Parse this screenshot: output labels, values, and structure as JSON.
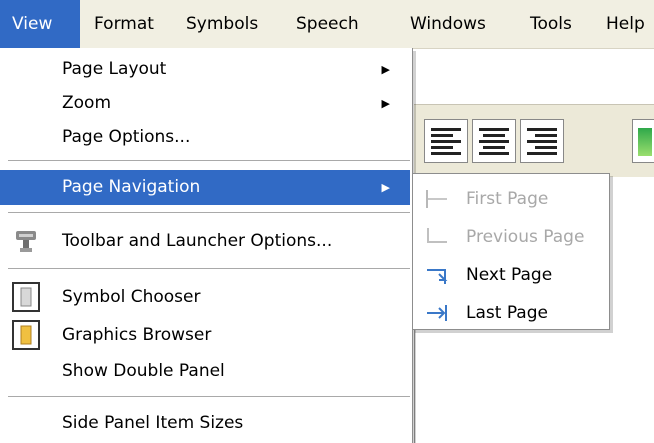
{
  "menubar": {
    "items": [
      {
        "label": "View",
        "active": true
      },
      {
        "label": "Format",
        "active": false
      },
      {
        "label": "Symbols",
        "active": false
      },
      {
        "label": "Speech",
        "active": false
      },
      {
        "label": "Windows",
        "active": false
      },
      {
        "label": "Tools",
        "active": false
      },
      {
        "label": "Help",
        "active": false
      }
    ]
  },
  "view_menu": {
    "items": [
      {
        "label": "Page Layout",
        "has_submenu": true
      },
      {
        "label": "Zoom",
        "has_submenu": true
      },
      {
        "label": "Page Options..."
      },
      {
        "label": "Page Navigation",
        "has_submenu": true,
        "highlighted": true
      },
      {
        "label": "Toolbar and Launcher Options...",
        "icon": "toolbar-settings-icon"
      },
      {
        "label": "Symbol Chooser",
        "icon": "symbol-chooser-icon"
      },
      {
        "label": "Graphics Browser",
        "icon": "graphics-browser-icon"
      },
      {
        "label": "Show Double Panel"
      },
      {
        "label": "Side Panel Item Sizes"
      }
    ]
  },
  "page_navigation_submenu": {
    "items": [
      {
        "label": "First Page",
        "enabled": false,
        "icon": "first-page-icon"
      },
      {
        "label": "Previous Page",
        "enabled": false,
        "icon": "previous-page-icon"
      },
      {
        "label": "Next Page",
        "enabled": true,
        "icon": "next-page-icon"
      },
      {
        "label": "Last Page",
        "enabled": true,
        "icon": "last-page-icon"
      }
    ]
  },
  "toolbar": {
    "buttons": [
      {
        "icon": "align-left-icon"
      },
      {
        "icon": "align-center-icon"
      },
      {
        "icon": "align-right-icon"
      }
    ]
  },
  "colors": {
    "highlight": "#316ac5",
    "menubar_bg": "#f1efe2",
    "disabled_text": "#a8a8a8",
    "nav_arrow": "#3a78c8"
  }
}
